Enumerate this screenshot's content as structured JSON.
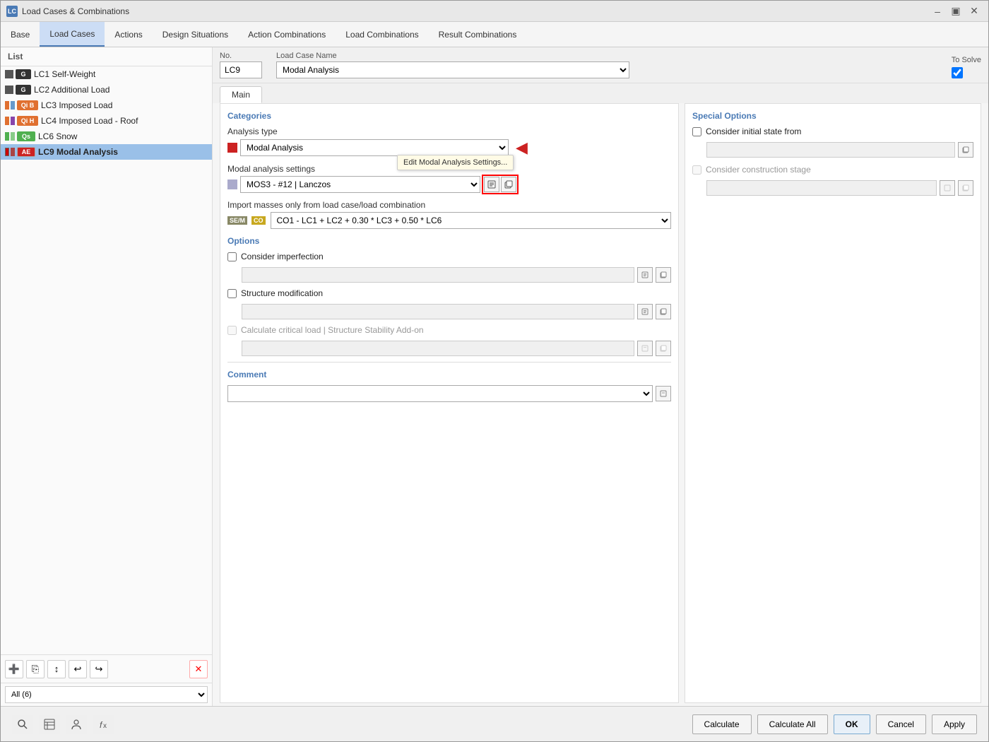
{
  "window": {
    "title": "Load Cases & Combinations",
    "icon": "LC"
  },
  "menubar": {
    "items": [
      {
        "id": "base",
        "label": "Base"
      },
      {
        "id": "load-cases",
        "label": "Load Cases"
      },
      {
        "id": "actions",
        "label": "Actions"
      },
      {
        "id": "design-situations",
        "label": "Design Situations"
      },
      {
        "id": "action-combinations",
        "label": "Action Combinations"
      },
      {
        "id": "load-combinations",
        "label": "Load Combinations"
      },
      {
        "id": "result-combinations",
        "label": "Result Combinations"
      }
    ]
  },
  "sidebar": {
    "header": "List",
    "items": [
      {
        "id": "LC1",
        "badge": "G",
        "badge_class": "lc-badge-g",
        "color_class": "color-g",
        "label": "LC1  Self-Weight",
        "selected": false
      },
      {
        "id": "LC2",
        "badge": "G",
        "badge_class": "lc-badge-g",
        "color_class": "color-g",
        "label": "LC2  Additional Load",
        "selected": false
      },
      {
        "id": "LC3",
        "badge": "QiB",
        "badge_class": "lc-badge-qi",
        "color_class": "color-qi",
        "label": "LC3  Imposed Load",
        "selected": false
      },
      {
        "id": "LC4",
        "badge": "QiH",
        "badge_class": "lc-badge-qi",
        "color_class": "color-qi",
        "label": "LC4  Imposed Load - Roof",
        "selected": false
      },
      {
        "id": "LC6",
        "badge": "Qs",
        "badge_class": "lc-badge-qs",
        "color_class": "color-qs",
        "label": "LC6  Snow",
        "selected": false
      },
      {
        "id": "LC9",
        "badge": "AE",
        "badge_class": "lc-badge-ae",
        "color_class": "color-ae",
        "label": "LC9  Modal Analysis",
        "selected": true
      }
    ],
    "filter_label": "All (6)"
  },
  "fields": {
    "no_label": "No.",
    "no_value": "LC9",
    "case_name_label": "Load Case Name",
    "case_name_value": "Modal Analysis",
    "to_solve_label": "To Solve"
  },
  "tabs": [
    {
      "id": "main",
      "label": "Main",
      "active": true
    }
  ],
  "main": {
    "categories_label": "Categories",
    "analysis_type_label": "Analysis type",
    "analysis_type_value": "Modal Analysis",
    "analysis_color": "#cc2222",
    "modal_settings_label": "Modal analysis settings",
    "modal_settings_value": "MOS3 - #12 | Lanczos",
    "tooltip_text": "Edit Modal Analysis Settings...",
    "import_label": "Import masses only from load case/load combination",
    "import_value": "CO1 - LC1 + LC2 + 0.30 * LC3 + 0.50 * LC6",
    "import_badge": "SE/M",
    "import_co_badge": "CO",
    "options_label": "Options",
    "consider_imperfection_label": "Consider imperfection",
    "structure_modification_label": "Structure modification",
    "critical_load_label": "Calculate critical load | Structure Stability Add-on",
    "special_options_label": "Special Options",
    "consider_initial_label": "Consider initial state from",
    "consider_construction_label": "Consider construction stage",
    "comment_label": "Comment"
  },
  "bottom": {
    "calculate_label": "Calculate",
    "calculate_all_label": "Calculate All",
    "ok_label": "OK",
    "cancel_label": "Cancel",
    "apply_label": "Apply"
  }
}
